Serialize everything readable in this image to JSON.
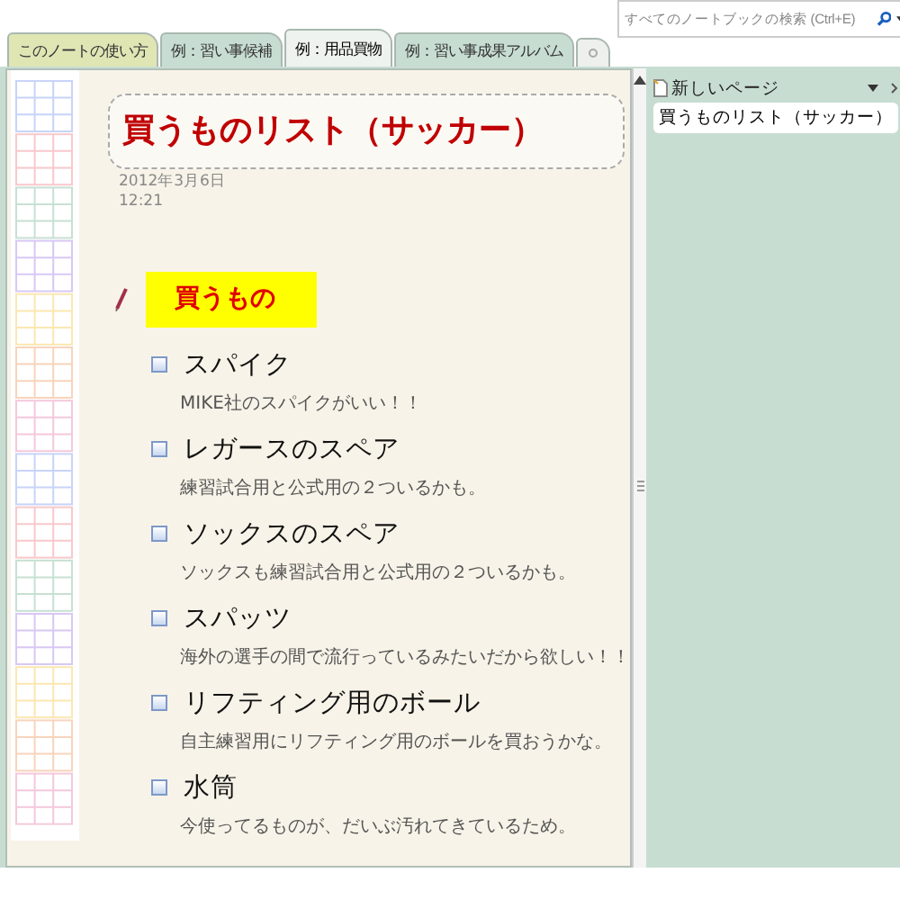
{
  "tabs": [
    {
      "label": "このノートの使い方",
      "selected": false,
      "color": "#dfe6b4"
    },
    {
      "label": "例：習い事候補",
      "selected": false,
      "color": "#c8ddd2"
    },
    {
      "label": "例：用品買物",
      "selected": true,
      "color": "#eef3ef"
    },
    {
      "label": "例：習い事成果アルバム",
      "selected": false,
      "color": "#c8ddd2"
    }
  ],
  "search": {
    "placeholder": "すべてのノートブックの検索 (Ctrl+E)"
  },
  "page": {
    "title": "買うものリスト（サッカー）",
    "date": "2012年3月6日",
    "time": "12:21",
    "heading": "買うもの",
    "items": [
      {
        "title": "スパイク",
        "note": "MIKE社のスパイクがいい！！",
        "checked": false
      },
      {
        "title": "レガースのスペア",
        "note": "練習試合用と公式用の２ついるかも。",
        "checked": false
      },
      {
        "title": "ソックスのスペア",
        "note": "ソックスも練習試合用と公式用の２ついるかも。",
        "checked": false
      },
      {
        "title": "スパッツ",
        "note": "海外の選手の間で流行っているみたいだから欲しい！！",
        "checked": false
      },
      {
        "title": "リフティング用のボール",
        "note": "自主練習用にリフティング用のボールを買おうかな。",
        "checked": false
      },
      {
        "title": "水筒",
        "note": "今使ってるものが、だいぶ汚れてきているため。",
        "checked": false
      }
    ]
  },
  "pages_pane": {
    "new_page": "新しいページ",
    "pages": [
      {
        "title": "買うものリスト（サッカー）",
        "selected": true
      }
    ]
  }
}
